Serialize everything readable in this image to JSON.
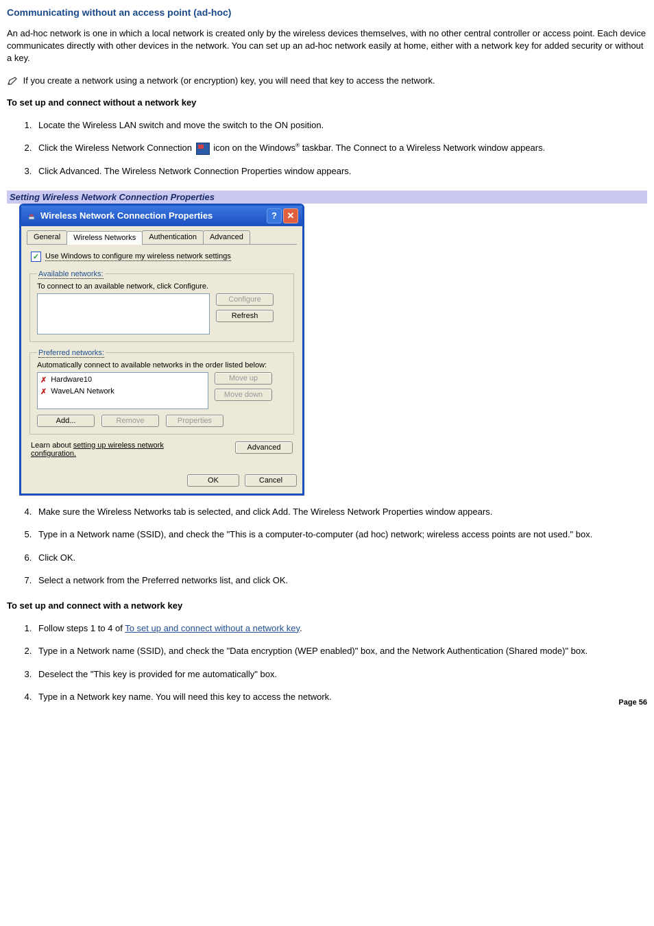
{
  "heading": "Communicating without an access point (ad-hoc)",
  "intro": "An ad-hoc network is one in which a local network is created only by the wireless devices themselves, with no other central controller or access point. Each device communicates directly with other devices in the network. You can set up an ad-hoc network easily at home, either with a network key for added security or without a key.",
  "note": "If you create a network using a network (or encryption) key, you will need that key to access the network.",
  "subhead1": "To set up and connect without a network key",
  "steps_a": {
    "s1": "Locate the Wireless LAN switch and move the switch to the ON position.",
    "s2a": "Click the Wireless Network Connection ",
    "s2b": " icon on the Windows",
    "s2c": " taskbar. The Connect to a Wireless Network window appears.",
    "s3": "Click Advanced. The Wireless Network Connection Properties window appears."
  },
  "caption": "Setting Wireless Network Connection Properties",
  "dialog": {
    "title": "Wireless Network Connection Properties",
    "tabs": {
      "general": "General",
      "wireless": "Wireless Networks",
      "auth": "Authentication",
      "adv": "Advanced"
    },
    "use_windows": "Use Windows to configure my wireless network settings",
    "available_legend": "Available networks:",
    "available_hint": "To connect to an available network, click Configure.",
    "configure": "Configure",
    "refresh": "Refresh",
    "preferred_legend": "Preferred networks:",
    "preferred_hint": "Automatically connect to available networks in the order listed below:",
    "items": {
      "item1": "Hardware10",
      "item2": "WaveLAN Network"
    },
    "moveup": "Move up",
    "movedown": "Move down",
    "add": "Add...",
    "remove": "Remove",
    "properties": "Properties",
    "learn_pre": "Learn about ",
    "learn_link": "setting up wireless network configuration.",
    "advanced": "Advanced",
    "ok": "OK",
    "cancel": "Cancel"
  },
  "steps_b": {
    "s4": "Make sure the Wireless Networks tab is selected, and click Add. The Wireless Network Properties window appears.",
    "s5": "Type in a Network name (SSID), and check the \"This is a computer-to-computer (ad hoc) network; wireless access points are not used.\" box.",
    "s6": "Click OK.",
    "s7": "Select a network from the Preferred networks list, and click OK."
  },
  "subhead2": "To set up and connect with a network key",
  "steps_c": {
    "s1a": "Follow steps 1 to 4 of ",
    "s1link": "To set up and connect without a network key",
    "s1b": ".",
    "s2": "Type in a Network name (SSID), and check the \"Data encryption (WEP enabled)\" box, and the Network Authentication (Shared mode)\" box.",
    "s3": "Deselect the \"This key is provided for me automatically\" box.",
    "s4": "Type in a Network key name. You will need this key to access the network."
  },
  "page_num": "Page 56"
}
